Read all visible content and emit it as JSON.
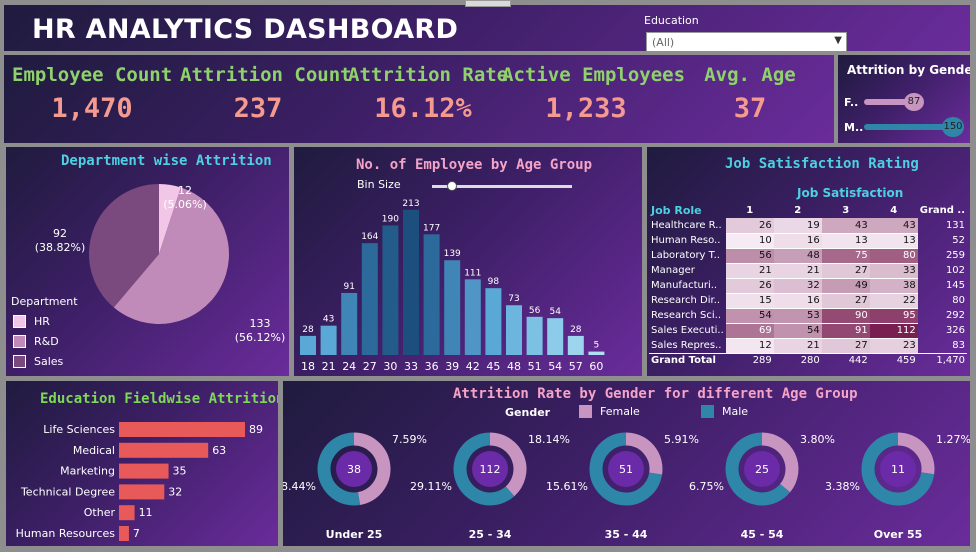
{
  "header": {
    "title": "HR ANALYTICS DASHBOARD",
    "filter_label": "Education",
    "filter_value": "(All)"
  },
  "kpis": [
    {
      "label": "Employee Count",
      "value": "1,470"
    },
    {
      "label": "Attrition Count",
      "value": "237"
    },
    {
      "label": "Attrition Rate",
      "value": "16.12%"
    },
    {
      "label": "Active Employees",
      "value": "1,233"
    },
    {
      "label": "Avg. Age",
      "value": "37"
    }
  ],
  "gender": {
    "title": "Attrition by Gender",
    "items": [
      {
        "label": "F..",
        "value": "87",
        "raw": 87
      },
      {
        "label": "M..",
        "value": "150",
        "raw": 150
      }
    ]
  },
  "department": {
    "title": "Department wise Attrition",
    "legend_title": "Department",
    "slices": [
      {
        "name": "HR",
        "value": 12,
        "label": "12",
        "pct": "(5.06%)",
        "color": "#f2c6e6"
      },
      {
        "name": "R&D",
        "value": 133,
        "label": "133",
        "pct": "(56.12%)",
        "color": "#c08bb9"
      },
      {
        "name": "Sales",
        "value": 92,
        "label": "92",
        "pct": "(38.82%)",
        "color": "#7a4a7f"
      }
    ]
  },
  "age_group": {
    "title": "No. of Employee by Age Group",
    "bin_label": "Bin Size",
    "slider_value": 0.1
  },
  "job_satisfaction": {
    "title": "Job Satisfaction Rating",
    "header": "Job Satisfaction",
    "row_header": "Job Role",
    "columns": [
      "1",
      "2",
      "3",
      "4",
      "Grand .."
    ],
    "rows": [
      {
        "role": "Healthcare R..",
        "values": [
          26,
          19,
          43,
          43
        ],
        "total": 131
      },
      {
        "role": "Human Reso..",
        "values": [
          10,
          16,
          13,
          13
        ],
        "total": 52
      },
      {
        "role": "Laboratory T..",
        "values": [
          56,
          48,
          75,
          80
        ],
        "total": 259
      },
      {
        "role": "Manager",
        "values": [
          21,
          21,
          27,
          33
        ],
        "total": 102
      },
      {
        "role": "Manufacturi..",
        "values": [
          26,
          32,
          49,
          38
        ],
        "total": 145
      },
      {
        "role": "Research Dir..",
        "values": [
          15,
          16,
          27,
          22
        ],
        "total": 80
      },
      {
        "role": "Research Sci..",
        "values": [
          54,
          53,
          90,
          95
        ],
        "total": 292
      },
      {
        "role": "Sales Executi..",
        "values": [
          69,
          54,
          91,
          112
        ],
        "total": 326
      },
      {
        "role": "Sales Repres..",
        "values": [
          12,
          21,
          27,
          23
        ],
        "total": 83
      }
    ],
    "grand_total_label": "Grand Total",
    "grand_totals": [
      "289",
      "280",
      "442",
      "459",
      "1,470"
    ]
  },
  "education_field": {
    "title": "Education Fieldwise Attrition"
  },
  "attrition_gender_age": {
    "title": "Attrition Rate by Gender for different Age Group",
    "legend_title": "Gender",
    "legend": [
      {
        "name": "Female",
        "color": "#c795c0"
      },
      {
        "name": "Male",
        "color": "#2e86a8"
      }
    ],
    "groups": [
      {
        "label": "Under 25",
        "center": "38",
        "female_pct": "7.59%",
        "male_pct": "8.44%",
        "female": 7.59,
        "male": 8.44
      },
      {
        "label": "25 - 34",
        "center": "112",
        "female_pct": "18.14%",
        "male_pct": "29.11%",
        "female": 18.14,
        "male": 29.11
      },
      {
        "label": "35 - 44",
        "center": "51",
        "female_pct": "5.91%",
        "male_pct": "15.61%",
        "female": 5.91,
        "male": 15.61
      },
      {
        "label": "45 - 54",
        "center": "25",
        "female_pct": "3.80%",
        "male_pct": "6.75%",
        "female": 3.8,
        "male": 6.75
      },
      {
        "label": "Over 55",
        "center": "11",
        "female_pct": "1.27%",
        "male_pct": "3.38%",
        "female": 1.27,
        "male": 3.38
      }
    ]
  },
  "colors": {
    "kpi_label": "#8fd26c",
    "kpi_value": "#f49a8e",
    "title_cyan": "#4dd0e1",
    "title_green": "#7ed957",
    "title_pink": "#f5a3c7",
    "bar_edu": "#e85a5a"
  },
  "chart_data": [
    {
      "type": "pie",
      "title": "Department wise Attrition",
      "categories": [
        "HR",
        "R&D",
        "Sales"
      ],
      "values": [
        12,
        133,
        92
      ]
    },
    {
      "type": "bar",
      "title": "No. of Employee by Age Group",
      "categories": [
        "18",
        "21",
        "24",
        "27",
        "30",
        "33",
        "36",
        "39",
        "42",
        "45",
        "48",
        "51",
        "54",
        "57",
        "60"
      ],
      "values": [
        28,
        43,
        91,
        164,
        190,
        213,
        177,
        139,
        111,
        98,
        73,
        56,
        54,
        28,
        5
      ],
      "xlabel": "",
      "ylabel": "",
      "ylim": [
        0,
        220
      ]
    },
    {
      "type": "bar",
      "title": "Education Fieldwise Attrition",
      "categories": [
        "Life Sciences",
        "Medical",
        "Marketing",
        "Technical Degree",
        "Other",
        "Human Resources"
      ],
      "values": [
        89,
        63,
        35,
        32,
        11,
        7
      ],
      "orientation": "horizontal"
    }
  ]
}
